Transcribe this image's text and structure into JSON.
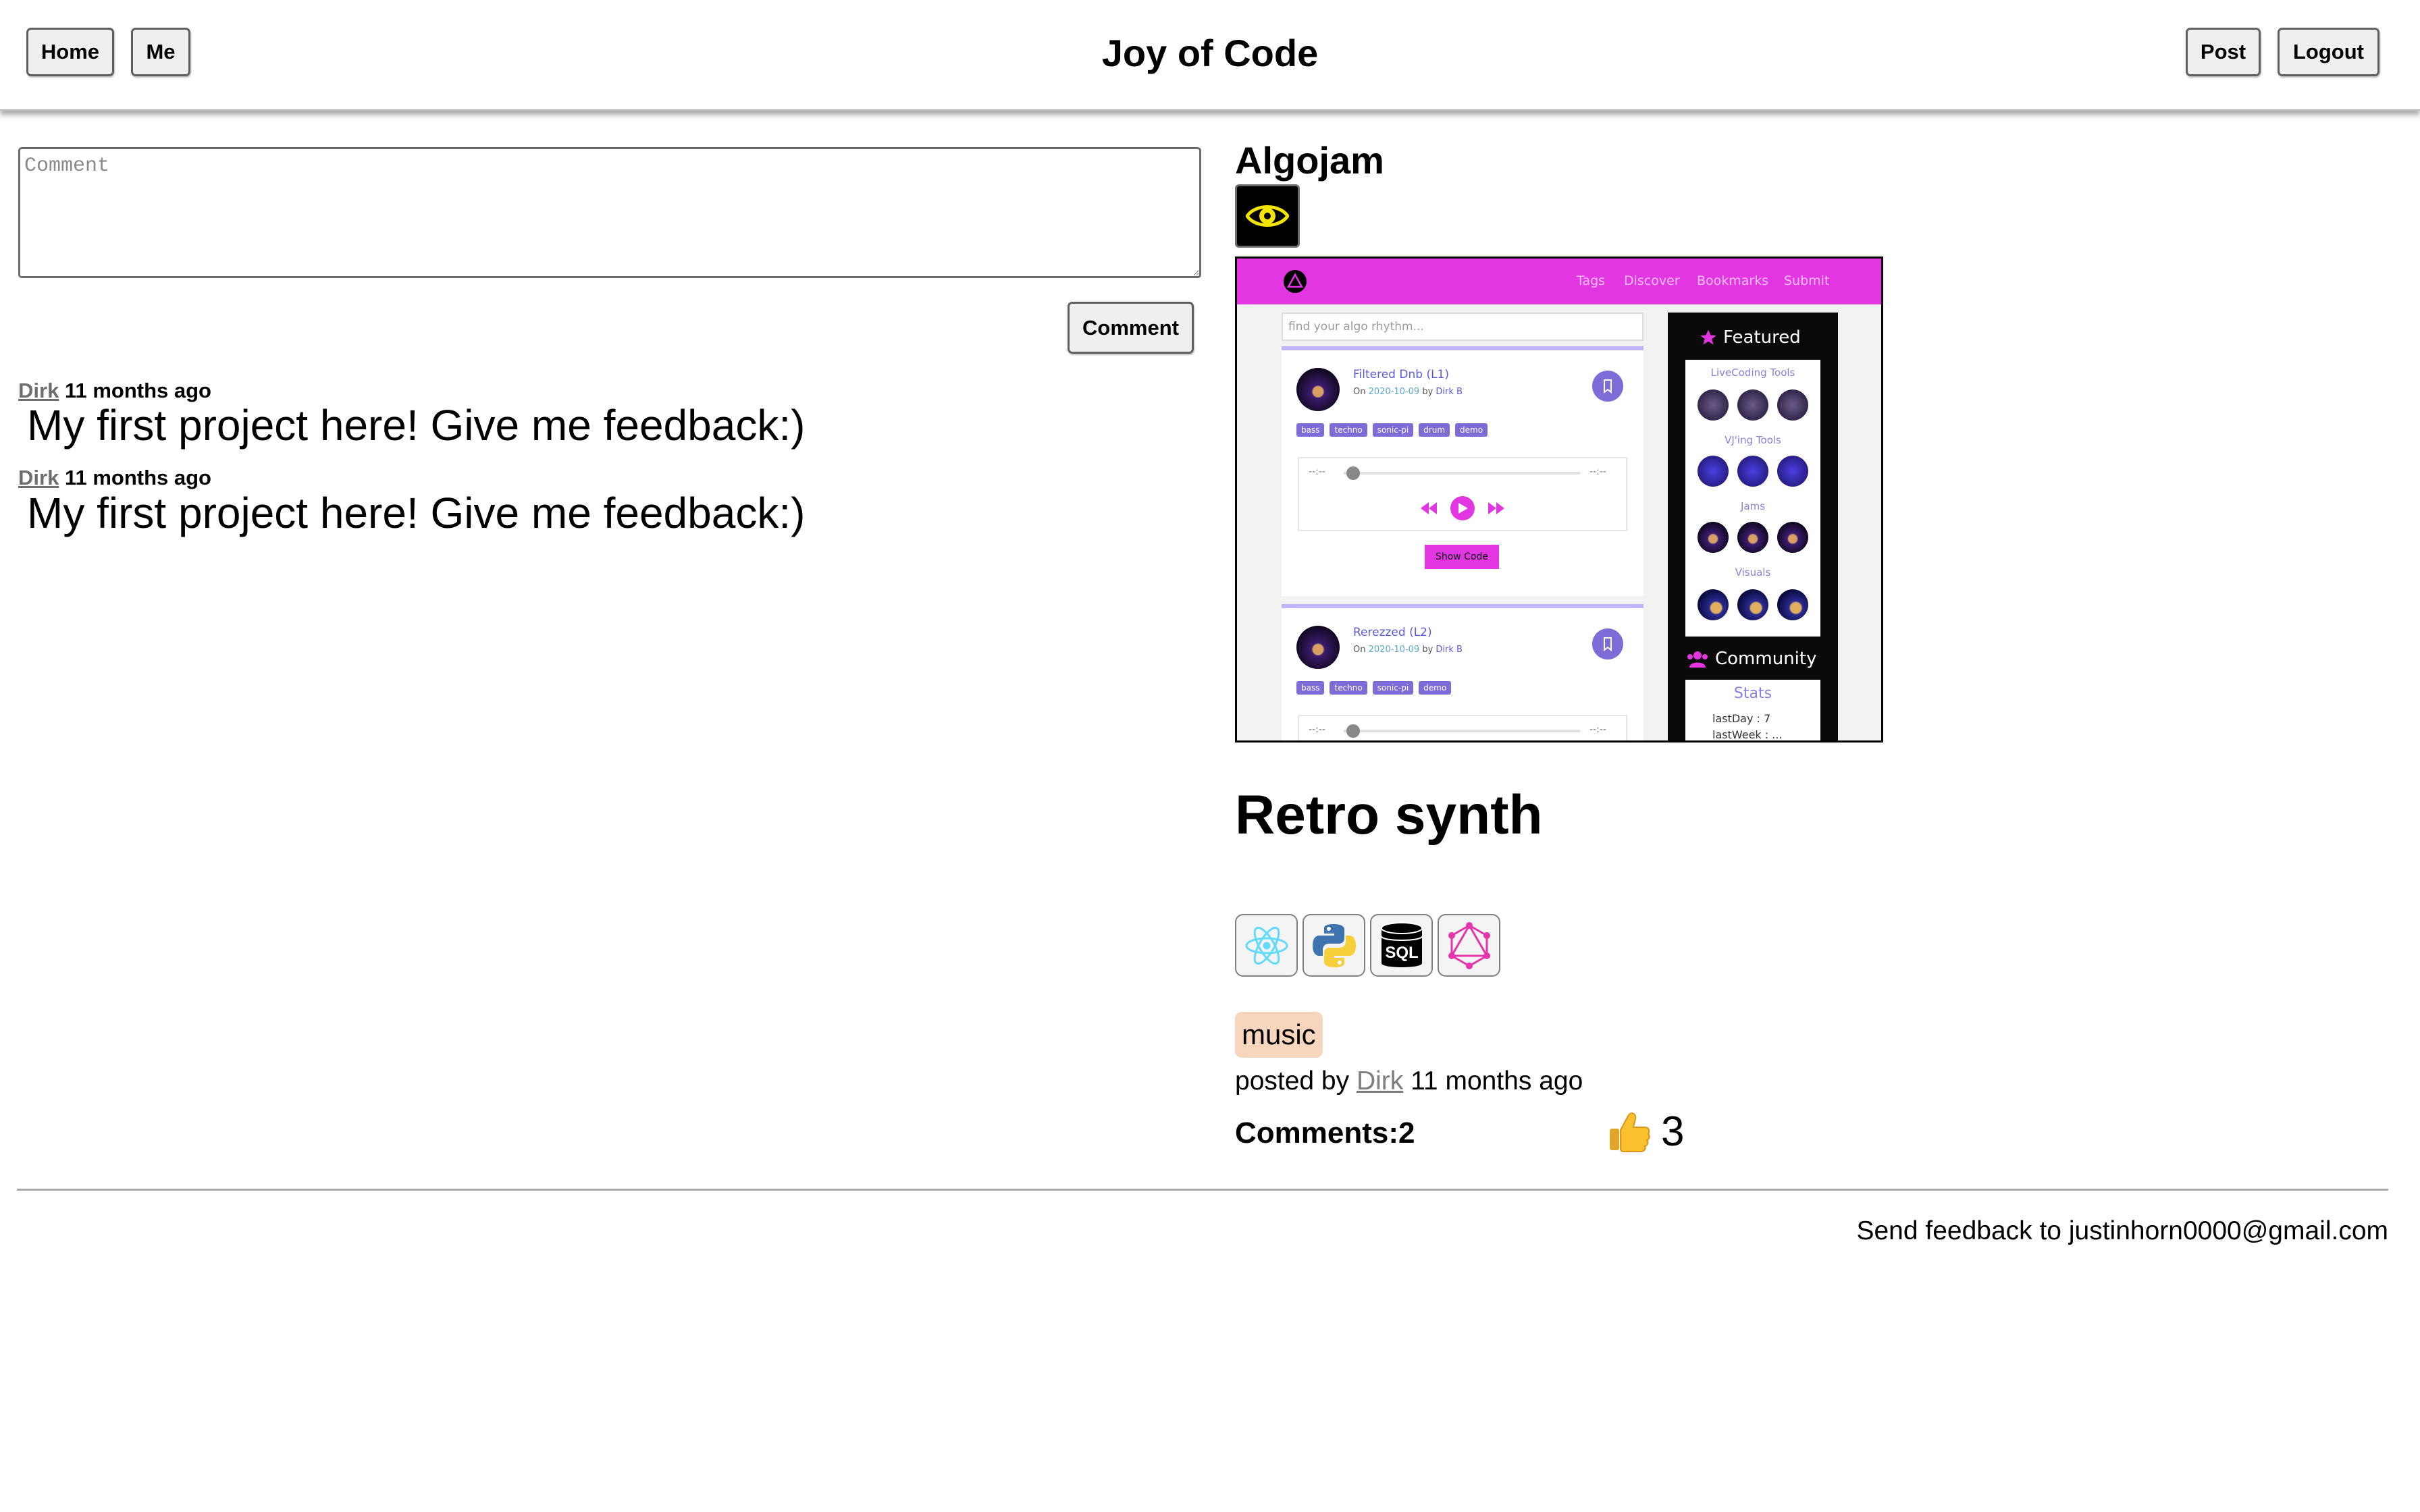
{
  "header": {
    "home_label": "Home",
    "me_label": "Me",
    "title": "Joy of Code",
    "post_label": "Post",
    "logout_label": "Logout"
  },
  "comment_form": {
    "placeholder": "Comment",
    "submit_label": "Comment"
  },
  "comments": [
    {
      "author": "Dirk",
      "time": "11 months ago",
      "text": "My first project here! Give me feedback:)"
    },
    {
      "author": "Dirk",
      "time": "11 months ago",
      "text": "My first project here! Give me feedback:)"
    }
  ],
  "project": {
    "name": "Algojam",
    "view_icon": "eye-icon",
    "screenshot": {
      "nav_links": [
        "Tags",
        "Discover",
        "Bookmarks",
        "Submit"
      ],
      "search_placeholder": "find your algo rhythm...",
      "tracks": [
        {
          "title": "Filtered Dnb (L1)",
          "on": "On",
          "date": "2020-10-09",
          "by": "by",
          "author": "Dirk B",
          "tags": [
            "bass",
            "techno",
            "sonic-pi",
            "drum",
            "demo"
          ]
        },
        {
          "title": "Rerezzed (L2)",
          "on": "On",
          "date": "2020-10-09",
          "by": "by",
          "author": "Dirk B",
          "tags": [
            "bass",
            "techno",
            "sonic-pi",
            "demo"
          ]
        }
      ],
      "time_left": "--:--",
      "time_right": "--:--",
      "show_code_label": "Show Code",
      "featured_title": "Featured",
      "featured_sections": [
        "LiveCoding Tools",
        "VJ'ing Tools",
        "Jams",
        "Visuals"
      ],
      "community_title": "Community",
      "stats_title": "Stats",
      "stats_line": "lastDay : 7",
      "stats_line2": "lastWeek : ..."
    },
    "subtitle": "Retro synth",
    "tech_icons": [
      "react-icon",
      "python-icon",
      "sql-database-icon",
      "graphql-icon"
    ],
    "tech_sql_text": "SQL",
    "tag": "music",
    "posted_by_prefix": "posted by",
    "author": "Dirk",
    "posted_time": "11 months ago",
    "comments_label": "Comments:2",
    "likes_count": "3",
    "like_icon": "thumbs-up-icon"
  },
  "footer": {
    "feedback_text": "Send feedback to justinhorn0000@gmail.com"
  },
  "colors": {
    "accent_magenta": "#e236e2",
    "tag_bg": "#f8d5bd",
    "link_gray": "#7d7d7d",
    "eye_yellow": "#f2e400",
    "mini_purple": "#7d6bd8"
  }
}
